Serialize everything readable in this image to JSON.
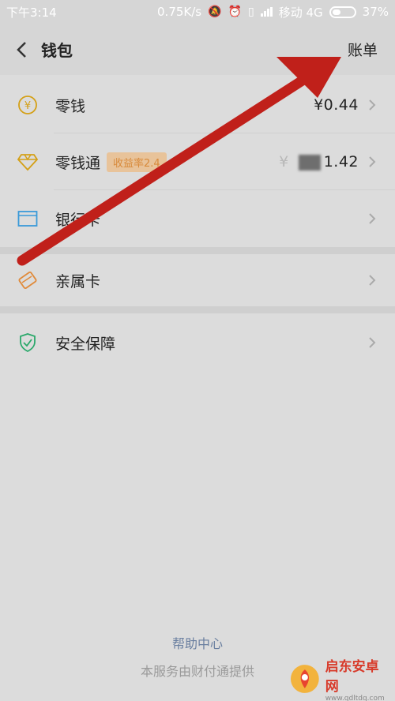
{
  "status_bar": {
    "time": "下午3:14",
    "speed": "0.75K/s",
    "carrier": "移动 4G",
    "battery": "37%"
  },
  "header": {
    "title": "钱包",
    "bill_label": "账单",
    "back_icon": "back-arrow-icon"
  },
  "items": [
    {
      "label": "零钱",
      "value": "¥0.44",
      "icon": "yen-coin-icon",
      "icon_color": "#d4a017"
    },
    {
      "label": "零钱通",
      "badge": "收益率2.4",
      "value_prefix": "¥",
      "value_suffix": "1.42",
      "icon": "diamond-icon",
      "icon_color": "#d4a017"
    },
    {
      "label": "银行卡",
      "icon": "bank-card-icon",
      "icon_color": "#3a9ad9"
    },
    {
      "label": "亲属卡",
      "icon": "family-card-icon",
      "icon_color": "#e08a3a"
    },
    {
      "label": "安全保障",
      "icon": "shield-check-icon",
      "icon_color": "#2aa86a"
    }
  ],
  "footer": {
    "help_label": "帮助中心",
    "provider_text": "本服务由财付通提供"
  },
  "watermark": {
    "title": "启东安卓网",
    "url": "www.qdltdq.com"
  },
  "colors": {
    "arrow": "#c0201a",
    "background": "#dcdcdc",
    "link": "#6a7fa0"
  }
}
